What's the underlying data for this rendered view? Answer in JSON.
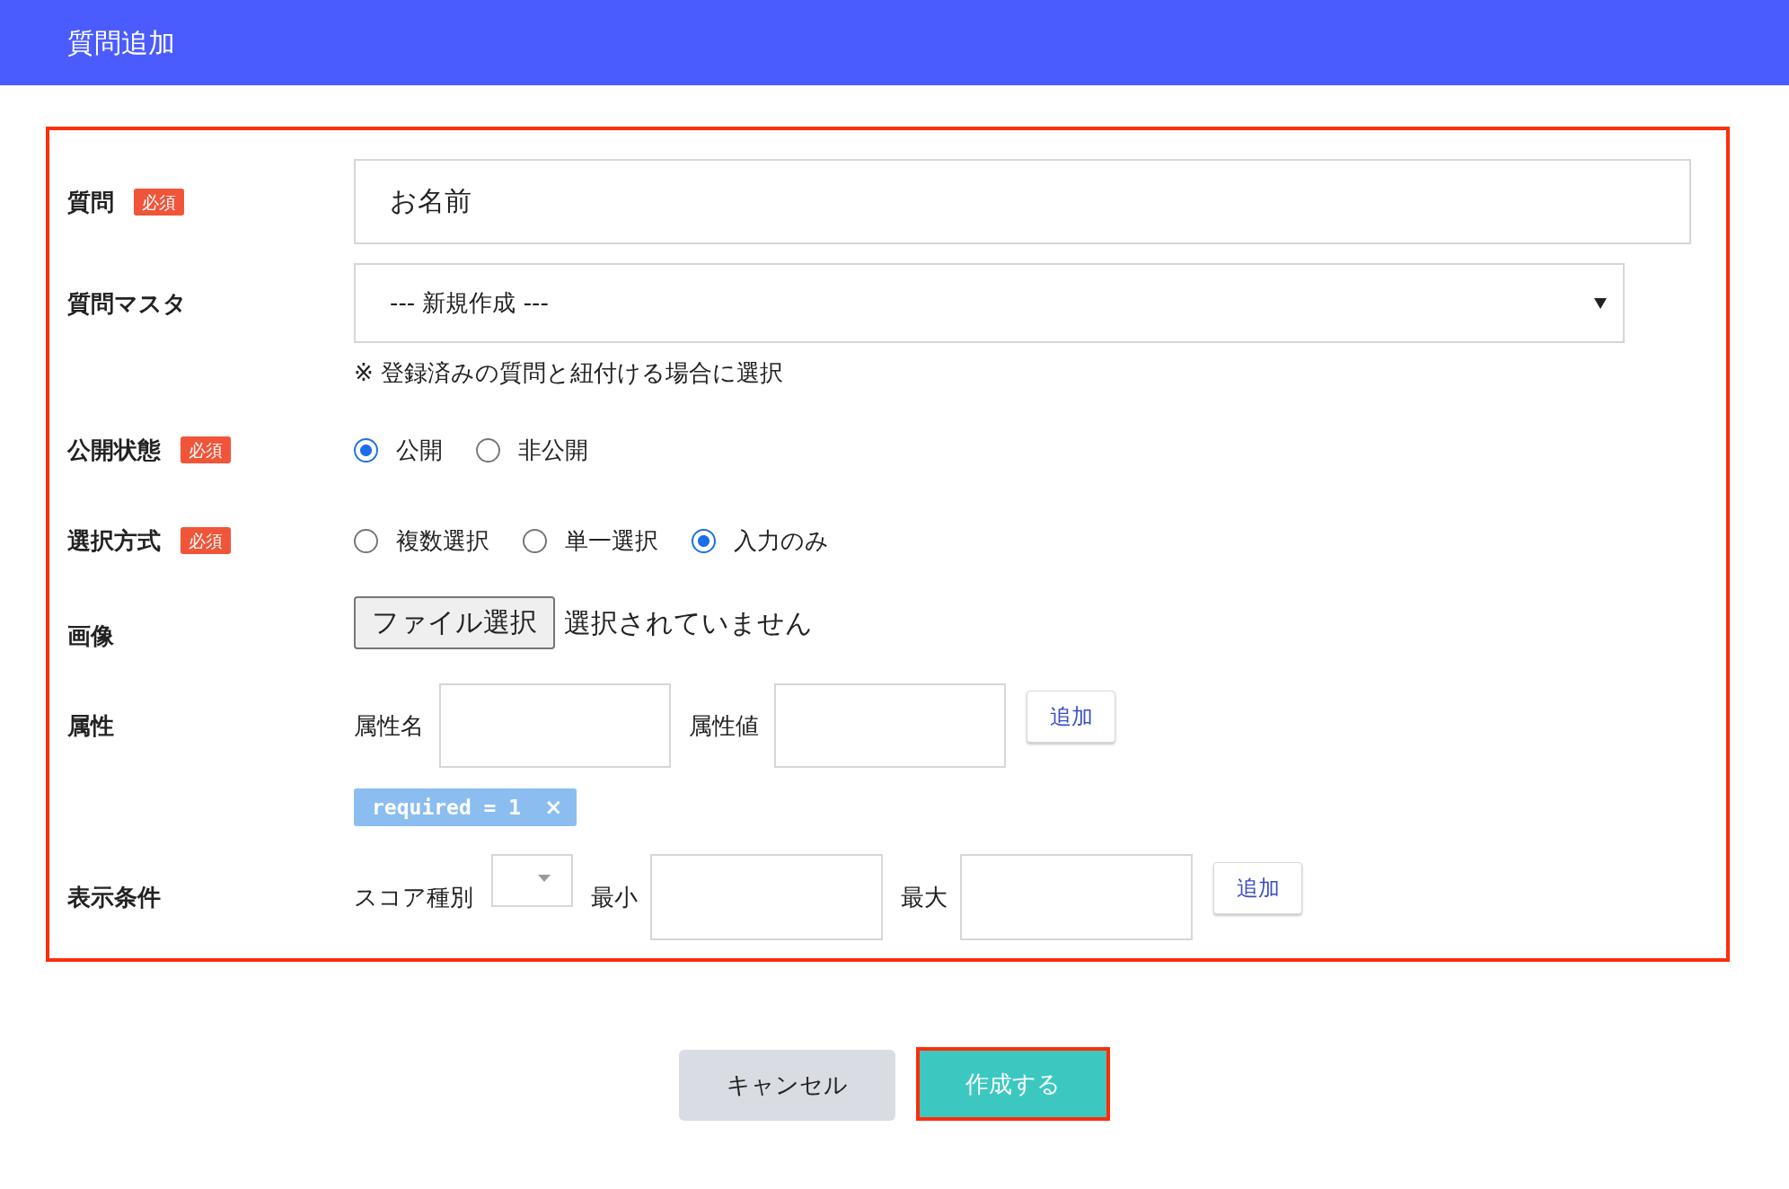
{
  "header": {
    "title": "質問追加"
  },
  "form": {
    "highlighted": true,
    "fields": [
      {
        "kind": "text",
        "label": "質問",
        "badge": "必須",
        "value": "お名前"
      },
      {
        "kind": "select",
        "label": "質問マスタ",
        "value": "--- 新規作成 ---",
        "hint": "※ 登録済みの質問と紐付ける場合に選択"
      },
      {
        "kind": "radio",
        "label": "公開状態",
        "badge": "必須",
        "options": [
          {
            "label": "公開",
            "selected": true
          },
          {
            "label": "非公開",
            "selected": false
          }
        ]
      },
      {
        "kind": "radio",
        "label": "選択方式",
        "badge": "必須",
        "options": [
          {
            "label": "複数選択",
            "selected": false
          },
          {
            "label": "単一選択",
            "selected": false
          },
          {
            "label": "入力のみ",
            "selected": true
          }
        ]
      },
      {
        "kind": "file",
        "label": "画像",
        "button": "ファイル選択",
        "status": "選択されていません"
      },
      {
        "kind": "attributes",
        "label": "属性",
        "name_label": "属性名",
        "value_label": "属性値",
        "add_button": "追加",
        "tags": [
          {
            "text": "required = 1",
            "remove": "×"
          }
        ]
      },
      {
        "kind": "conditions",
        "label": "表示条件",
        "score_type_label": "スコア種別",
        "min_label": "最小",
        "max_label": "最大",
        "add_button": "追加"
      }
    ]
  },
  "actions": [
    {
      "kind": "secondary",
      "label": "キャンセル",
      "highlighted": false
    },
    {
      "kind": "primary",
      "label": "作成する",
      "highlighted": true
    }
  ]
}
